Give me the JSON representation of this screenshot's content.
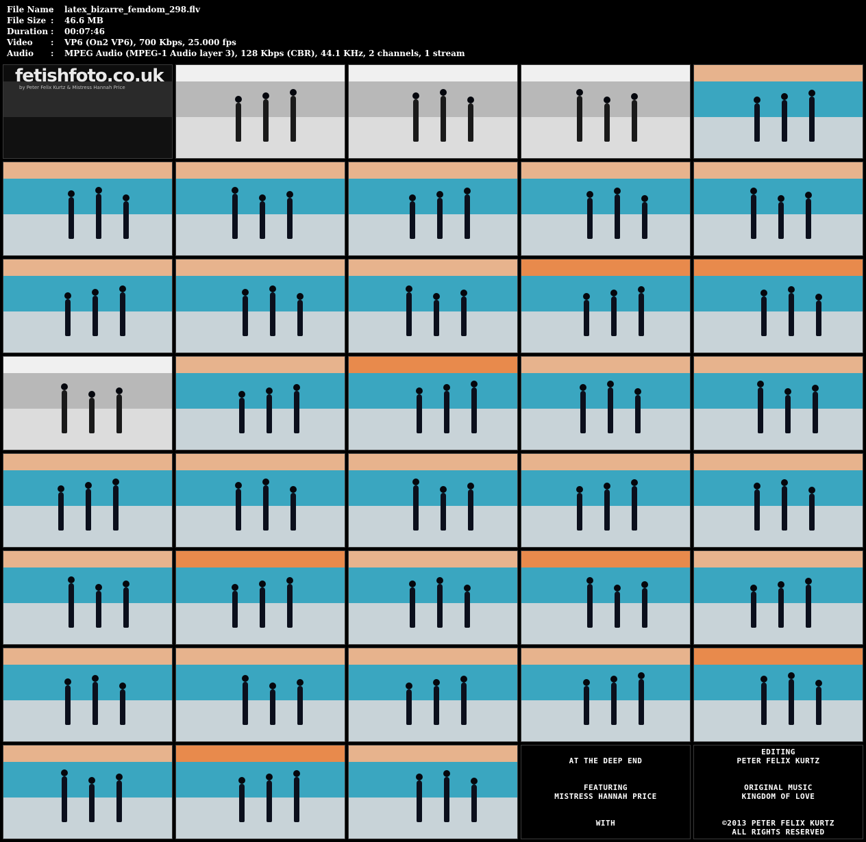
{
  "file_info": [
    {
      "label": "File Name",
      "value": "latex_bizarre_femdom_298.flv"
    },
    {
      "label": "File Size",
      "value": "46.6 MB"
    },
    {
      "label": "Duration",
      "value": "00:07:46"
    },
    {
      "label": "Video",
      "value": "VP6 (On2 VP6), 700 Kbps, 25.000 fps"
    },
    {
      "label": "Audio",
      "value": "MPEG Audio (MPEG-1 Audio layer 3), 128 Kbps (CBR), 44.1 KHz, 2 channels, 1 stream"
    }
  ],
  "separator": ":",
  "logo": {
    "text": "fetishfoto.co.uk",
    "sub": "by Peter Felix Kurtz & Mistress Hannah Price"
  },
  "title_cards": [
    {
      "lines": [
        "AT THE DEEP END",
        "",
        "FEATURING",
        "MISTRESS HANNAH PRICE",
        "",
        "WITH"
      ]
    },
    {
      "lines": [
        "EDITING",
        "PETER FELIX KURTZ",
        "",
        "ORIGINAL MUSIC",
        "KINGDOM OF LOVE",
        "",
        "©2013 PETER FELIX KURTZ",
        "ALL RIGHTS RESERVED"
      ]
    }
  ],
  "colors": {
    "pool": "#3aa6c0",
    "floor": "#c8d3d8",
    "orange": "#e88a4c",
    "gray_pool": "#b8b8b8",
    "gray_floor": "#dcdcdc"
  }
}
